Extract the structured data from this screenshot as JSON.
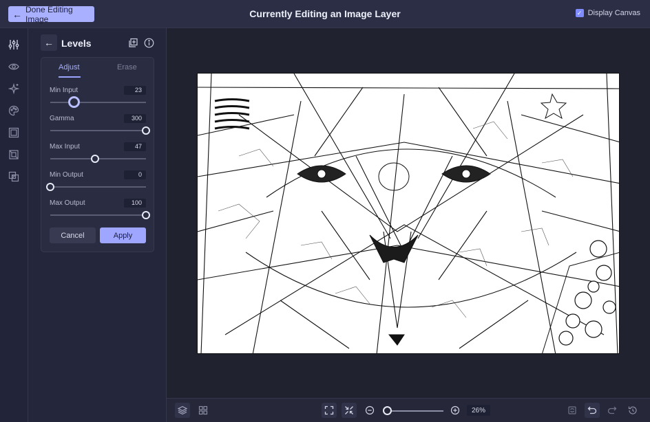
{
  "header": {
    "done_label": "Done Editing Image",
    "title": "Currently Editing an Image Layer",
    "display_canvas_label": "Display Canvas",
    "display_canvas_checked": true
  },
  "sidebar_icons": [
    "sliders-icon",
    "eye-icon",
    "sparkle-icon",
    "palette-icon",
    "frame-icon",
    "crop-icon",
    "layers-overlap-icon"
  ],
  "panel": {
    "title": "Levels",
    "tabs": [
      "Adjust",
      "Erase"
    ],
    "active_tab": "Adjust",
    "rows": [
      {
        "label": "Min Input",
        "value": "23",
        "level": 0.25
      },
      {
        "label": "Gamma",
        "value": "300",
        "level": 1.0
      },
      {
        "label": "Max Input",
        "value": "47",
        "level": 0.47
      },
      {
        "label": "Min Output",
        "value": "0",
        "level": 0.0
      },
      {
        "label": "Max Output",
        "value": "100",
        "level": 1.0
      }
    ],
    "cancel_label": "Cancel",
    "apply_label": "Apply"
  },
  "bottom": {
    "zoom_value": "26%",
    "zoom_level": 0.05
  },
  "colors": {
    "accent": "#a9b0ff",
    "background": "#20222f"
  }
}
